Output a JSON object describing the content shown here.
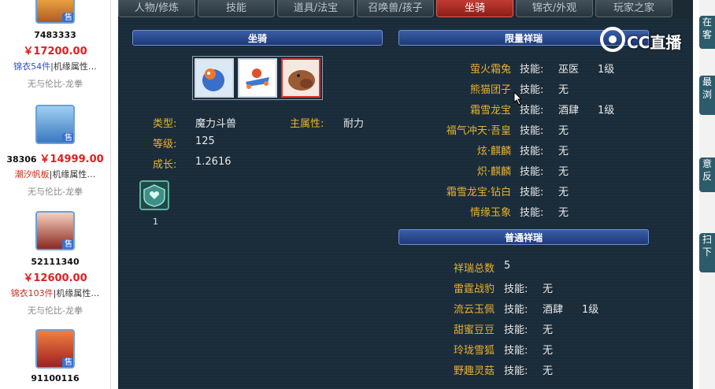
{
  "listings": [
    {
      "id": "7483333",
      "price": "￥17200.00",
      "attr_a": "锦衣54件",
      "attr_b": "|机缘属性…",
      "server": "无与伦比-龙拳",
      "sale": "售"
    },
    {
      "id": "38306",
      "price": "￥14999.00",
      "attr_a": "潮汐帆板",
      "attr_b": "|机缘属性…",
      "server": "无与伦比-龙拳",
      "sale": "售"
    },
    {
      "id": "52111340",
      "price": "￥12600.00",
      "attr_a": "锦衣103件",
      "attr_b": "|机缘属性…",
      "server": "无与伦比-龙拳",
      "sale": "售"
    },
    {
      "id": "91100116",
      "price": "",
      "attr_a": "",
      "attr_b": "",
      "server": "",
      "sale": "售"
    }
  ],
  "tabs": [
    "人物/修炼",
    "技能",
    "道具/法宝",
    "召唤兽/孩子",
    "坐骑",
    "锦衣/外观",
    "玩家之家"
  ],
  "active_tab": "坐骑",
  "mount_section": {
    "title": "坐骑"
  },
  "mount_info": {
    "type_label": "类型:",
    "type_value": "魔力斗兽",
    "attr_label": "主属性:",
    "attr_value": "耐力",
    "level_label": "等级:",
    "level_value": "125",
    "growth_label": "成长:",
    "growth_value": "1.2616",
    "badge_count": "1"
  },
  "limited_section": {
    "title": "限量祥瑞",
    "items": [
      {
        "name": "萤火霜兔",
        "skill": "技能:",
        "skill_value": "巫医",
        "level": "1级"
      },
      {
        "name": "熊猫团子",
        "skill": "技能:",
        "skill_value": "无",
        "level": ""
      },
      {
        "name": "霜雪龙宝",
        "skill": "技能:",
        "skill_value": "酒肆",
        "level": "1级"
      },
      {
        "name": "福气冲天·吾皇",
        "skill": "技能:",
        "skill_value": "无",
        "level": ""
      },
      {
        "name": "炫·麒麟",
        "skill": "技能:",
        "skill_value": "无",
        "level": ""
      },
      {
        "name": "炽·麒麟",
        "skill": "技能:",
        "skill_value": "无",
        "level": ""
      },
      {
        "name": "霜雪龙宝·钻白",
        "skill": "技能:",
        "skill_value": "无",
        "level": ""
      },
      {
        "name": "情缘玉象",
        "skill": "技能:",
        "skill_value": "无",
        "level": ""
      }
    ]
  },
  "normal_section": {
    "title": "普通祥瑞",
    "total_label": "祥瑞总数",
    "total_value": "5",
    "items": [
      {
        "name": "雷霆战豹",
        "skill": "技能:",
        "skill_value": "无",
        "level": ""
      },
      {
        "name": "流云玉佩",
        "skill": "技能:",
        "skill_value": "酒肆",
        "level": "1级"
      },
      {
        "name": "甜蜜豆豆",
        "skill": "技能:",
        "skill_value": "无",
        "level": ""
      },
      {
        "name": "玲珑雪狐",
        "skill": "技能:",
        "skill_value": "无",
        "level": ""
      },
      {
        "name": "野趣灵菇",
        "skill": "技能:",
        "skill_value": "无",
        "level": ""
      }
    ]
  },
  "watermark": "CC直播",
  "side_buttons": [
    "在客",
    "最浏",
    "意反",
    "扫下"
  ],
  "colors": {
    "panel": "#1a2c3a",
    "label_gold": "#e8b030",
    "active_tab": "#c03a32",
    "price_red": "#e02020",
    "header_blue": "#2e4c94"
  }
}
